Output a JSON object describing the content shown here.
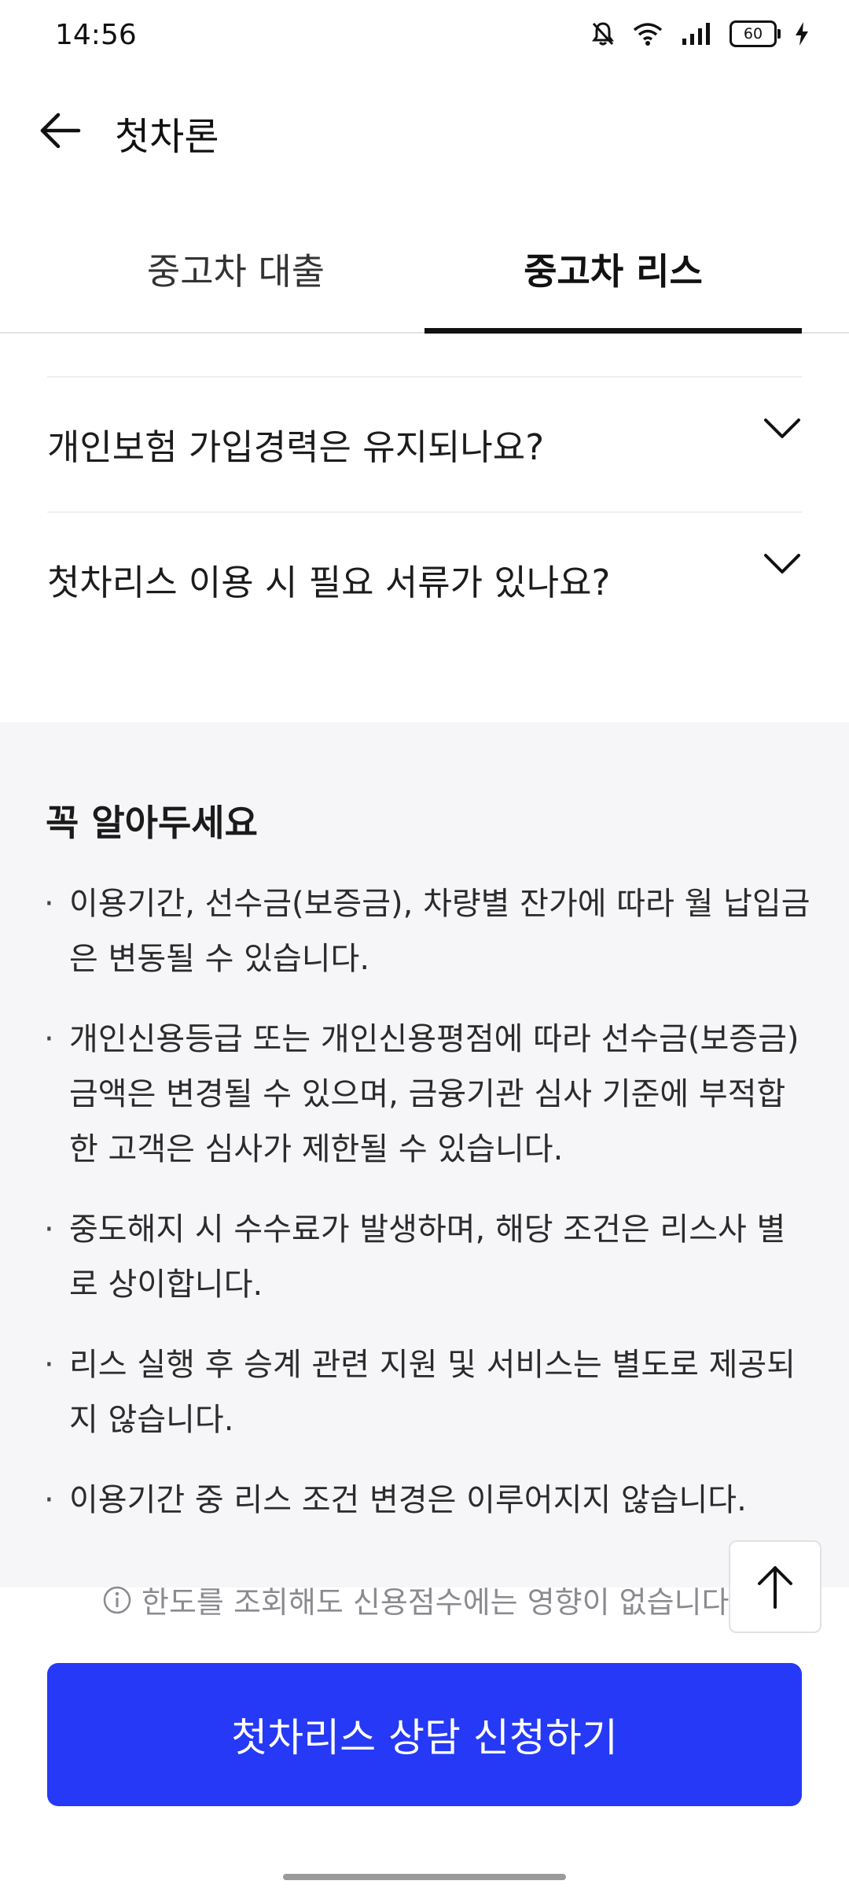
{
  "status_bar": {
    "time": "14:56",
    "battery": "60",
    "icons": [
      "bell-muted-icon",
      "wifi-icon",
      "signal-icon",
      "battery-icon",
      "charging-bolt-icon"
    ]
  },
  "header": {
    "title": "첫차론",
    "back_icon": "arrow-left-icon"
  },
  "tabs": [
    {
      "label": "중고차 대출",
      "selected": false
    },
    {
      "label": "중고차 리스",
      "selected": true
    }
  ],
  "faq": [
    {
      "question": "개인보험 가입경력은 유지되나요?"
    },
    {
      "question": "첫차리스 이용 시 필요 서류가 있나요?"
    }
  ],
  "notice": {
    "title": "꼭 알아두세요",
    "items": [
      "이용기간, 선수금(보증금), 차량별 잔가에 따라 월 납입금은 변동될 수 있습니다.",
      "개인신용등급 또는 개인신용평점에 따라 선수금(보증금) 금액은 변경될 수 있으며, 금융기관 심사 기준에 부적합한 고객은 심사가 제한될 수 있습니다.",
      "중도해지 시 수수료가 발생하며, 해당 조건은 리스사 별로 상이합니다.",
      "리스 실행 후 승계 관련 지원 및 서비스는 별도로 제공되지 않습니다.",
      "이용기간 중 리스 조건 변경은 이루어지지 않습니다."
    ]
  },
  "info_text": "한도를 조회해도 신용점수에는 영향이 없습니다",
  "cta_label": "첫차리스 상담 신청하기",
  "colors": {
    "accent": "#2539f6",
    "section_bg": "#f6f6f8",
    "text": "#1b1b1b"
  }
}
